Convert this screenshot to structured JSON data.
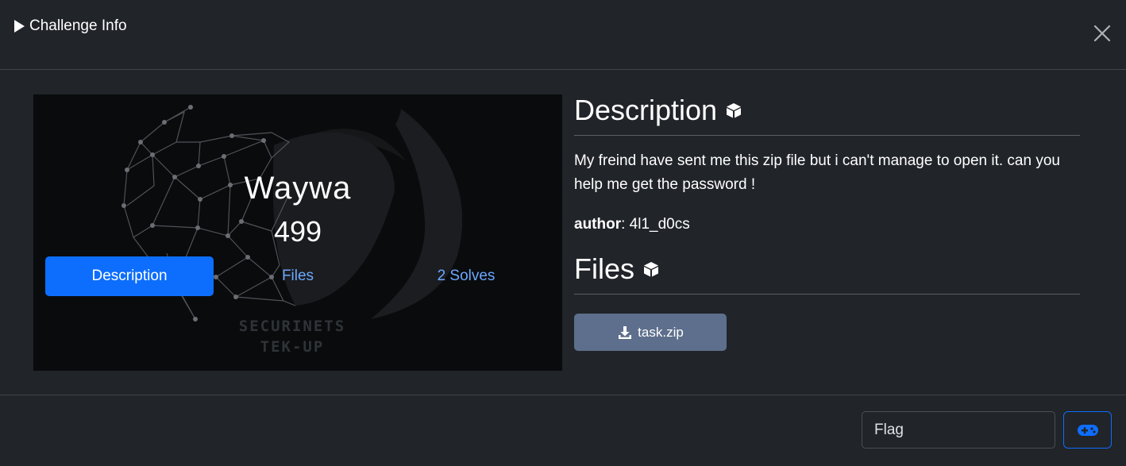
{
  "modal": {
    "title": "Challenge Info",
    "title_icon": "play-icon",
    "close_icon": "close-icon"
  },
  "challenge": {
    "name": "Waywa",
    "points": "499",
    "banner_lines": [
      "SECURINETS",
      "TEK-UP"
    ]
  },
  "tabs": [
    {
      "label": "Description",
      "active": true
    },
    {
      "label": "Files",
      "active": false
    },
    {
      "label": "2 Solves",
      "active": false
    }
  ],
  "description": {
    "heading": "Description",
    "text": "My freind have sent me this zip file but i can't manage to open it. can you help me get the password !",
    "author_label": "author",
    "author_value": ": 4l1_d0cs"
  },
  "files": {
    "heading": "Files",
    "items": [
      {
        "label": "task.zip",
        "icon": "download-icon"
      }
    ]
  },
  "flag": {
    "placeholder": "Flag",
    "submit_icon": "gamepad-icon"
  },
  "colors": {
    "background": "#212429",
    "primary": "#0d6efd",
    "link": "#6ea8fe",
    "download_button": "#5d6f8c"
  }
}
